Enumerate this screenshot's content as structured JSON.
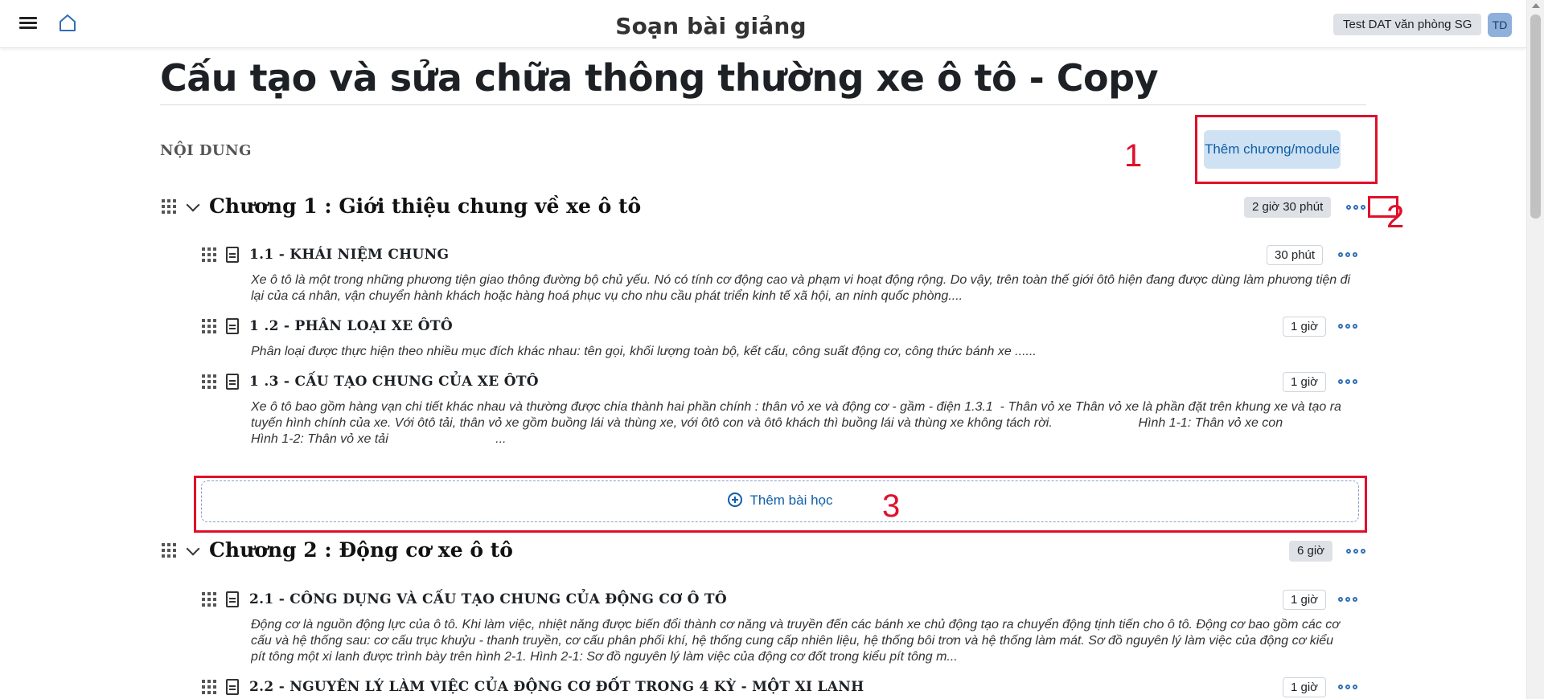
{
  "header": {
    "title": "Soạn bài giảng",
    "user_name": "Test DAT văn phòng SG",
    "avatar_initials": "TD"
  },
  "course": {
    "title": "Cấu tạo và sửa chữa thông thường xe ô tô - Copy",
    "section_label": "NỘI DUNG",
    "add_module_label": "Thêm chương/module",
    "add_lesson_label": "Thêm bài học"
  },
  "annotations": [
    "1",
    "2",
    "3"
  ],
  "chapters": [
    {
      "title": "Chương 1 : Giới thiệu chung về xe ô tô",
      "duration": "2 giờ 30 phút",
      "lessons": [
        {
          "title": "1.1 - KHÁI NIỆM CHUNG",
          "duration": "30 phút",
          "desc": "Xe ô tô là một trong những phương tiện giao thông đường bộ chủ yếu. Nó có tính cơ động cao và phạm vi hoạt động rộng. Do vậy, trên toàn thế giới ôtô hiện đang được dùng làm phương tiện đi lại của cá nhân, vận chuyển hành khách hoặc hàng hoá phục vụ cho nhu cầu phát triển kinh tế xã hội, an ninh quốc phòng...."
        },
        {
          "title": "1 .2 - PHÂN LOẠI XE ÔTÔ",
          "duration": "1 giờ",
          "desc": "Phân loại được thực hiện theo nhiều mục đích khác nhau: tên gọi, khối lượng toàn bộ, kết cấu, công suất động cơ, công thức bánh xe ......"
        },
        {
          "title": "1 .3 - CẤU TẠO CHUNG CỦA XE ÔTÔ",
          "duration": "1 giờ",
          "desc": "Xe ô tô bao gồm hàng vạn chi tiết khác nhau và thường được chia thành hai phần chính : thân vỏ xe và động cơ - gầm - điện 1.3.1  - Thân vỏ xe Thân vỏ xe là phần đặt trên khung xe và tạo ra tuyến hình chính của xe. Với ôtô tải, thân vỏ xe gồm buồng lái và thùng xe, với ôtô con và ôtô khách thì buồng lái và thùng xe không tách rời.                        Hình 1-1: Thân vỏ xe con                                                Hình 1-2: Thân vỏ xe tải                              ..."
        }
      ]
    },
    {
      "title": "Chương 2 : Động cơ xe ô tô",
      "duration": "6 giờ",
      "lessons": [
        {
          "title": "2.1 - CÔNG DỤNG VÀ CẤU TẠO CHUNG CỦA ĐỘNG CƠ Ô TÔ",
          "duration": "1 giờ",
          "desc": "Động cơ là nguồn động lực của ô tô. Khi làm việc, nhiệt năng được biến đổi thành cơ năng và truyền đến các bánh xe chủ động tạo ra chuyển động tịnh tiến cho ô tô. Động cơ bao gồm các cơ cấu và hệ thống sau: cơ cấu trục khuỷu - thanh truyền, cơ cấu phân phối khí, hệ thống cung cấp nhiên liệu, hệ thống bôi trơn và hệ thống làm mát. Sơ đồ nguyên lý làm việc của động cơ kiểu pít tông một xi lanh được trình bày trên hình 2-1. Hình 2-1: Sơ đồ nguyên lý làm việc của động cơ đốt trong kiểu pít tông m..."
        },
        {
          "title": "2.2 - NGUYÊN LÝ LÀM VIỆC CỦA ĐỘNG CƠ ĐỐT TRONG 4 KỲ - MỘT XI LANH",
          "duration": "1 giờ",
          "desc": ""
        }
      ]
    }
  ]
}
